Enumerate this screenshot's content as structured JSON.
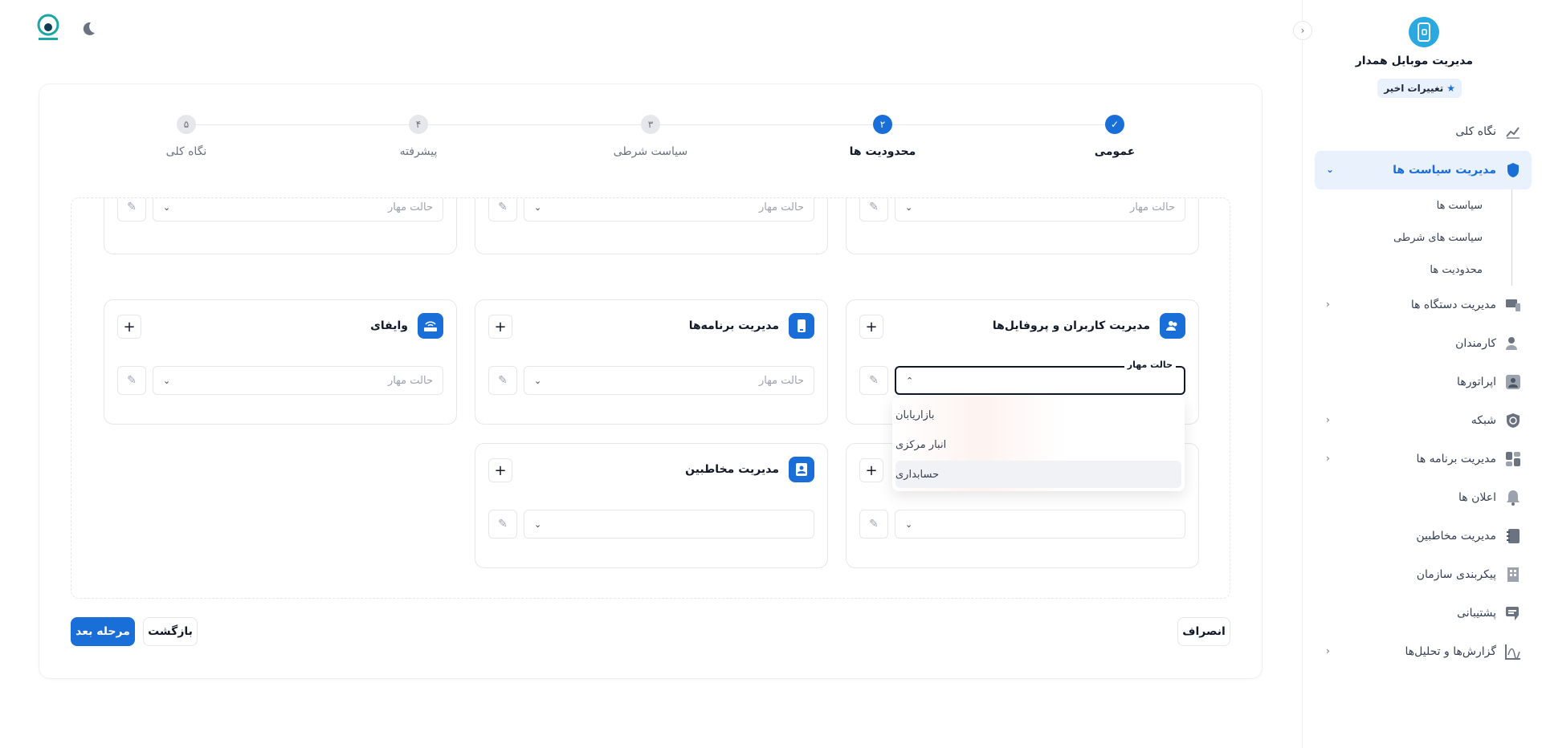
{
  "header": {
    "logo_icon": "logo-icon",
    "theme_toggle_icon": "moon-icon"
  },
  "sidebar": {
    "app_title": "مدیریت موبایل همدار",
    "changes_badge": "تغییرات اخیر",
    "items": [
      {
        "label": "نگاه کلی",
        "icon": "chart-icon"
      },
      {
        "label": "مدیریت سیاست ها",
        "icon": "shield-icon",
        "active": true,
        "expanded": true,
        "children": [
          "سیاست ها",
          "سیاست های شرطی",
          "محدودیت ها"
        ]
      },
      {
        "label": "مدیریت دستگاه ها",
        "icon": "devices-icon",
        "has_children": true
      },
      {
        "label": "کارمندان",
        "icon": "users-icon"
      },
      {
        "label": "اپراتورها",
        "icon": "operator-icon"
      },
      {
        "label": "شبکه",
        "icon": "network-icon",
        "has_children": true
      },
      {
        "label": "مدیریت برنامه ها",
        "icon": "apps-icon",
        "has_children": true
      },
      {
        "label": "اعلان ها",
        "icon": "bell-icon"
      },
      {
        "label": "مدیریت مخاطبین",
        "icon": "contacts-icon"
      },
      {
        "label": "پیکربندی سازمان",
        "icon": "building-icon"
      },
      {
        "label": "پشتیبانی",
        "icon": "support-icon"
      },
      {
        "label": "گزارش‌ها و تحلیل‌ها",
        "icon": "report-icon",
        "has_children": true
      }
    ]
  },
  "stepper": {
    "steps": [
      {
        "number": "✓",
        "label": "عمومی",
        "state": "done"
      },
      {
        "number": "۲",
        "label": "محدودیت ها",
        "state": "current"
      },
      {
        "number": "۳",
        "label": "سیاست شرطی",
        "state": "pending"
      },
      {
        "number": "۴",
        "label": "پیشرفته",
        "state": "pending"
      },
      {
        "number": "۵",
        "label": "نگاه کلی",
        "state": "pending"
      }
    ]
  },
  "cards": {
    "select_placeholder": "حالت مهار",
    "users_profiles": {
      "title": "مدیریت کاربران و پروفایل‌ها",
      "field_label": "حالت مهار"
    },
    "apps": {
      "title": "مدیریت برنامه‌ها"
    },
    "wifi": {
      "title": "وایفای"
    },
    "contacts": {
      "title": "مدیریت مخاطبین"
    }
  },
  "dropdown": {
    "options": [
      "بازاریابان",
      "انبار مرکزی",
      "حسابداری"
    ],
    "highlighted_index": 2
  },
  "footer": {
    "next_label": "مرحله بعد",
    "back_label": "بازگشت",
    "cancel_label": "انصراف"
  },
  "colors": {
    "primary": "#1a6ed8",
    "app_icon": "#2aa8e0"
  }
}
